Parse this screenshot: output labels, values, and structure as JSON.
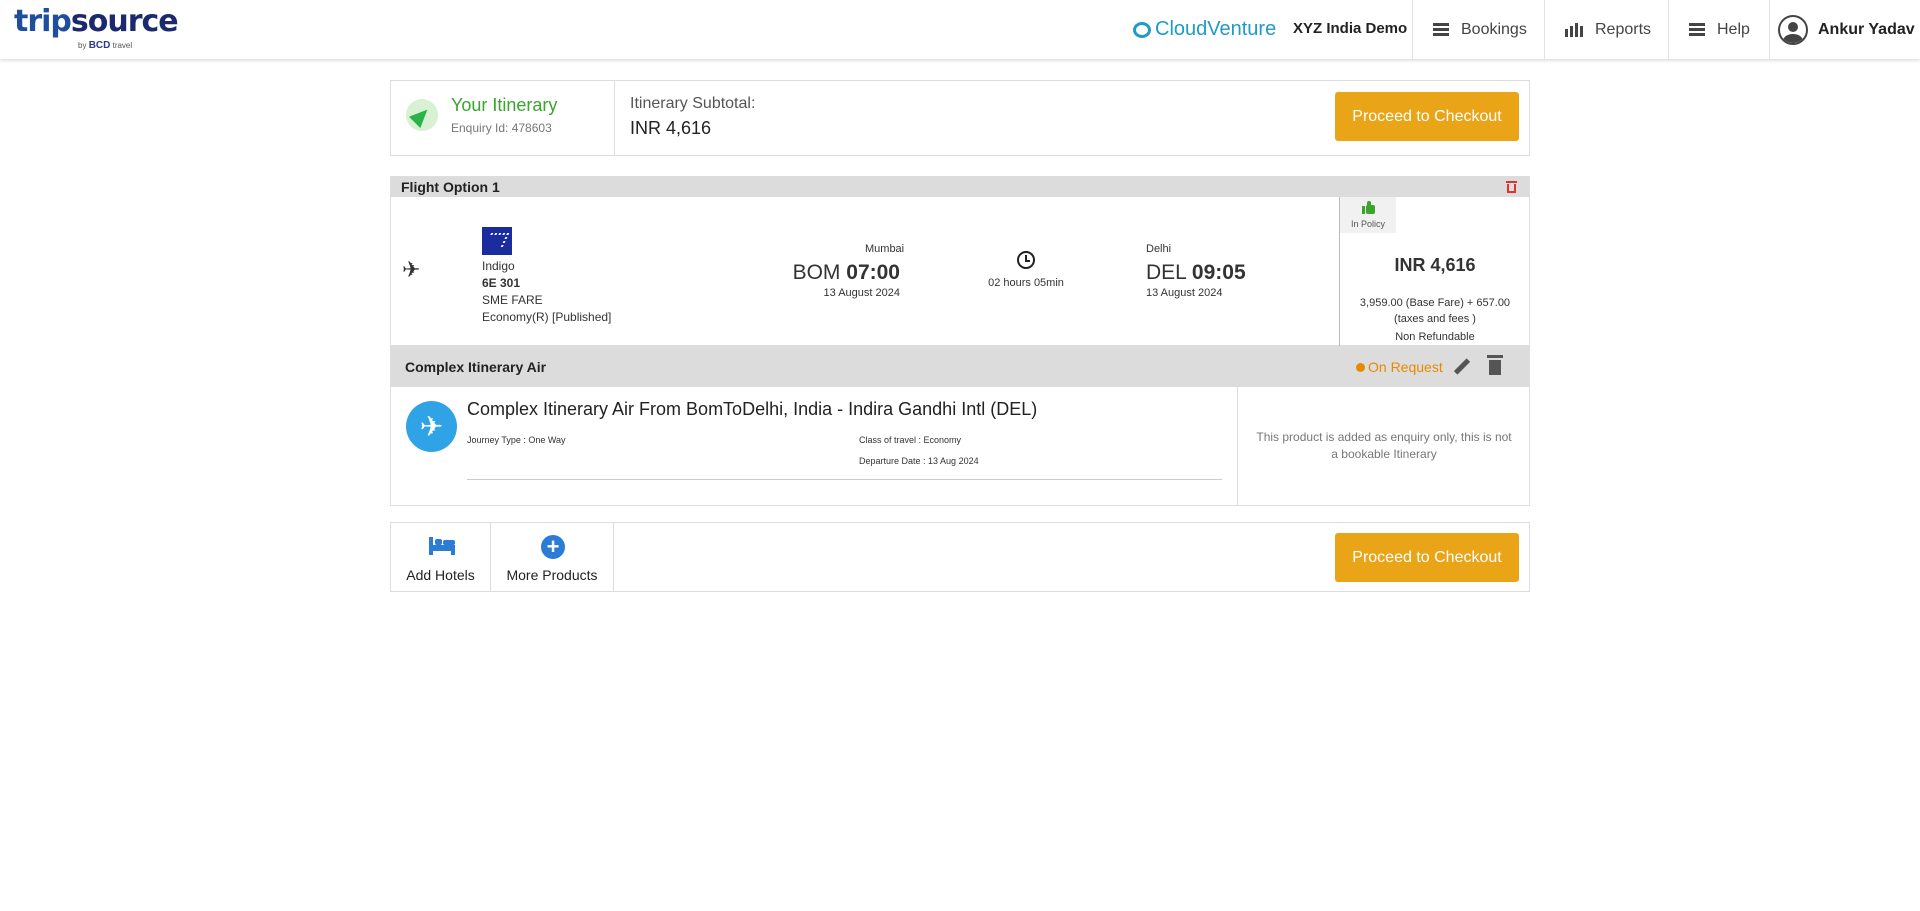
{
  "header": {
    "logo_main_1": "trip",
    "logo_main_2": "source",
    "logo_sub": "by",
    "logo_sub_brand": "BCD",
    "logo_sub_2": "travel",
    "brand_partner": "CloudVenture",
    "client_name": "XYZ India Demo",
    "nav": {
      "bookings": "Bookings",
      "reports": "Reports",
      "help": "Help",
      "user": "Ankur Yadav"
    }
  },
  "summary": {
    "title": "Your Itinerary",
    "enquiry": "Enquiry Id: 478603",
    "subtotal_label": "Itinerary Subtotal:",
    "subtotal_value": "INR  4,616",
    "checkout_label": "Proceed to Checkout"
  },
  "flight_option": {
    "title": "Flight Option 1",
    "airline": "Indigo",
    "flight_no": "6E 301",
    "fare_type": "SME FARE",
    "cabin": "Economy(R) [Published]",
    "departure": {
      "city": "Mumbai",
      "code": "BOM",
      "time": "07:00",
      "date": "13 August 2024"
    },
    "duration": "02 hours 05min",
    "arrival": {
      "city": "Delhi",
      "code": "DEL",
      "time": "09:05",
      "date": "13 August 2024"
    },
    "policy": "In Policy",
    "price": "INR 4,616",
    "price_breakdown": "3,959.00 (Base Fare) + 657.00 (taxes and fees )",
    "refundability": "Non Refundable"
  },
  "complex_itinerary": {
    "title": "Complex Itinerary Air",
    "status": "On Request",
    "main_title": "Complex Itinerary Air From BomToDelhi, India - Indira Gandhi Intl (DEL)",
    "journey_type": "Journey Type : One Way",
    "class_of_travel": "Class of travel : Economy",
    "departure_date": "Departure Date : 13 Aug 2024",
    "note": "This product is added as enquiry only, this is not a bookable Itinerary"
  },
  "bottom": {
    "add_hotels": "Add Hotels",
    "more_products": "More Products",
    "checkout_label": "Proceed to Checkout"
  },
  "colors": {
    "accent_button": "#e9a417",
    "itinerary_green": "#3aa42b",
    "status_orange": "#e68a00",
    "brand_blue": "#2a7cd6"
  },
  "icons": {
    "menu": "menu-icon",
    "reports": "bar-chart-icon",
    "user": "user-avatar-icon",
    "itinerary": "navigation-arrow-icon",
    "delete": "trash-icon",
    "flight": "plane-icon",
    "duration": "clock-icon",
    "policy": "thumbs-up-icon",
    "edit": "pencil-icon",
    "hotel": "bed-icon",
    "more": "plus-circle-icon"
  }
}
